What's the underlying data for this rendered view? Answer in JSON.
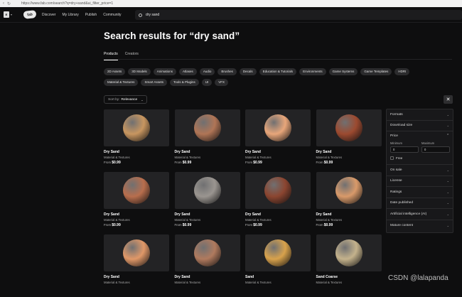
{
  "browser": {
    "url": "https://www.fab.com/search?q=dry+sand&ui_filter_price=1"
  },
  "topnav": {
    "logo": "fab",
    "links": [
      "Discover",
      "My Library",
      "Publish",
      "Community"
    ],
    "search_value": "dry sand"
  },
  "page": {
    "title": "Search results for “dry sand”",
    "tabs": [
      "Products",
      "Creators"
    ],
    "chips": [
      "2D Assets",
      "3D Models",
      "Animations",
      "Atlases",
      "Audio",
      "Brushes",
      "Decals",
      "Education & Tutorials",
      "Environments",
      "Game Systems",
      "Game Templates",
      "HDRI",
      "Material & Textures",
      "Smart Assets",
      "Tools & Plugins",
      "UI",
      "VFX"
    ],
    "sort_label": "Sort by:",
    "sort_value": "Relevance",
    "close_glyph": "✕"
  },
  "products": [
    {
      "title": "Dry Sand",
      "category": "Material & Textures",
      "from": "From",
      "price": "$0.99",
      "color": "#c89660"
    },
    {
      "title": "Dry Sand",
      "category": "Material & Textures",
      "from": "From",
      "price": "$0.99",
      "color": "#b07556"
    },
    {
      "title": "Dry Sand",
      "category": "Material & Textures",
      "from": "From",
      "price": "$0.99",
      "color": "#e8a67a"
    },
    {
      "title": "Dry Sand",
      "category": "Material & Textures",
      "from": "From",
      "price": "$0.99",
      "color": "#9c4a30"
    },
    {
      "title": "Dry Sand",
      "category": "Material & Textures",
      "from": "From",
      "price": "$0.99",
      "color": "#b86e4d"
    },
    {
      "title": "Dry Sand",
      "category": "Material & Textures",
      "from": "From",
      "price": "$0.99",
      "color": "#9a9590"
    },
    {
      "title": "Dry Sand",
      "category": "Material & Textures",
      "from": "From",
      "price": "$0.99",
      "color": "#8b4530"
    },
    {
      "title": "Dry Sand",
      "category": "Material & Textures",
      "from": "From",
      "price": "$0.99",
      "color": "#d99a6a"
    },
    {
      "title": "Dry Sand",
      "category": "Material & Textures",
      "from": "",
      "price": "",
      "color": "#e09868"
    },
    {
      "title": "Dry Sand",
      "category": "Material & Textures",
      "from": "",
      "price": "",
      "color": "#b07a5e"
    },
    {
      "title": "Sand",
      "category": "Material & Textures",
      "from": "",
      "price": "",
      "color": "#d8a24c"
    },
    {
      "title": "Sand Coarse",
      "category": "Material & Textures",
      "from": "",
      "price": "",
      "color": "#c4b28c"
    }
  ],
  "filters": {
    "formats": "Formats",
    "download_size": "Download size",
    "price": "Price",
    "minimum": "Minimum",
    "maximum": "Maximum",
    "min_value": "0",
    "max_value": "0",
    "free": "Free",
    "rest": [
      "On sale",
      "License",
      "Ratings",
      "Date published",
      "Artificial intelligence (AI)",
      "Mature content"
    ]
  },
  "watermark": "CSDN @lalapanda"
}
